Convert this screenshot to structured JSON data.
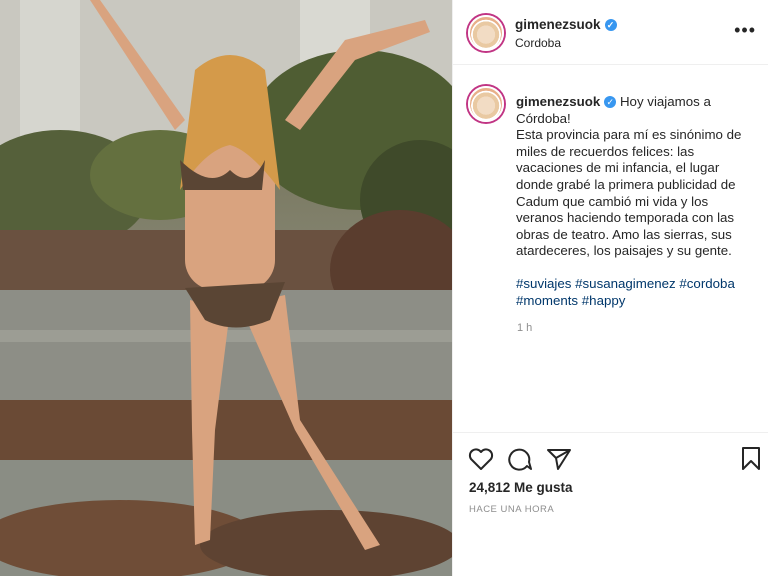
{
  "post": {
    "username": "gimenezsuok",
    "location": "Cordoba",
    "more_label": "•••",
    "verified_mark": "✓",
    "caption_lines": [
      "Hoy viajamos a",
      "Córdoba!",
      "Esta provincia para mí es sinónimo de",
      "miles de recuerdos felices: las",
      "vacaciones de mi infancia, el lugar",
      "donde grabé la primera publicidad de",
      "Cadum que cambió mi vida y los",
      "veranos haciendo temporada con las",
      "obras de teatro. Amo las sierras, sus",
      "atardeceres, los paisajes y su gente."
    ],
    "hashtags_line1": [
      "#suviajes",
      "#susanagimenez",
      "#cordoba"
    ],
    "hashtags_line2": [
      "#moments",
      "#happy"
    ],
    "comment_age": "1 h",
    "likes": "24,812 Me gusta",
    "posted": "HACE UNA HORA"
  },
  "icons": {
    "like": "heart-icon",
    "comment": "comment-icon",
    "share": "paper-plane-icon",
    "save": "bookmark-icon"
  }
}
